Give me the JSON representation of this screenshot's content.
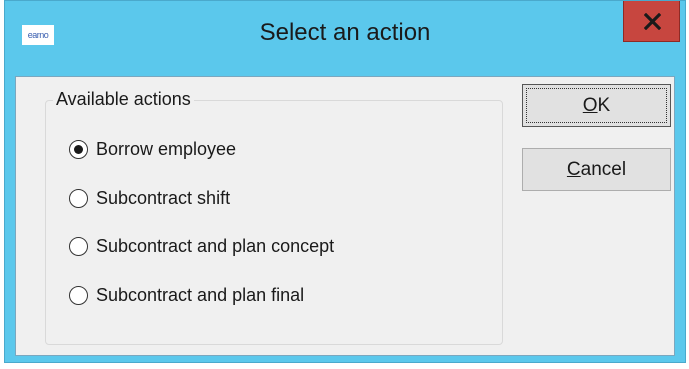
{
  "window": {
    "title": "Select an action",
    "app_icon_text": "earno",
    "close_glyph": "close-icon"
  },
  "group": {
    "label": "Available actions",
    "options": [
      {
        "label": "Borrow employee",
        "checked": true
      },
      {
        "label": "Subcontract shift",
        "checked": false
      },
      {
        "label": "Subcontract and plan concept",
        "checked": false
      },
      {
        "label": "Subcontract and plan final",
        "checked": false
      }
    ]
  },
  "buttons": {
    "ok_label": "OK",
    "ok_mnemonic": "O",
    "cancel_label": "Cancel",
    "cancel_mnemonic": "C"
  },
  "colors": {
    "titlebar": "#5bc8ec",
    "close_button": "#c7463f",
    "client": "#f0f0f0"
  }
}
